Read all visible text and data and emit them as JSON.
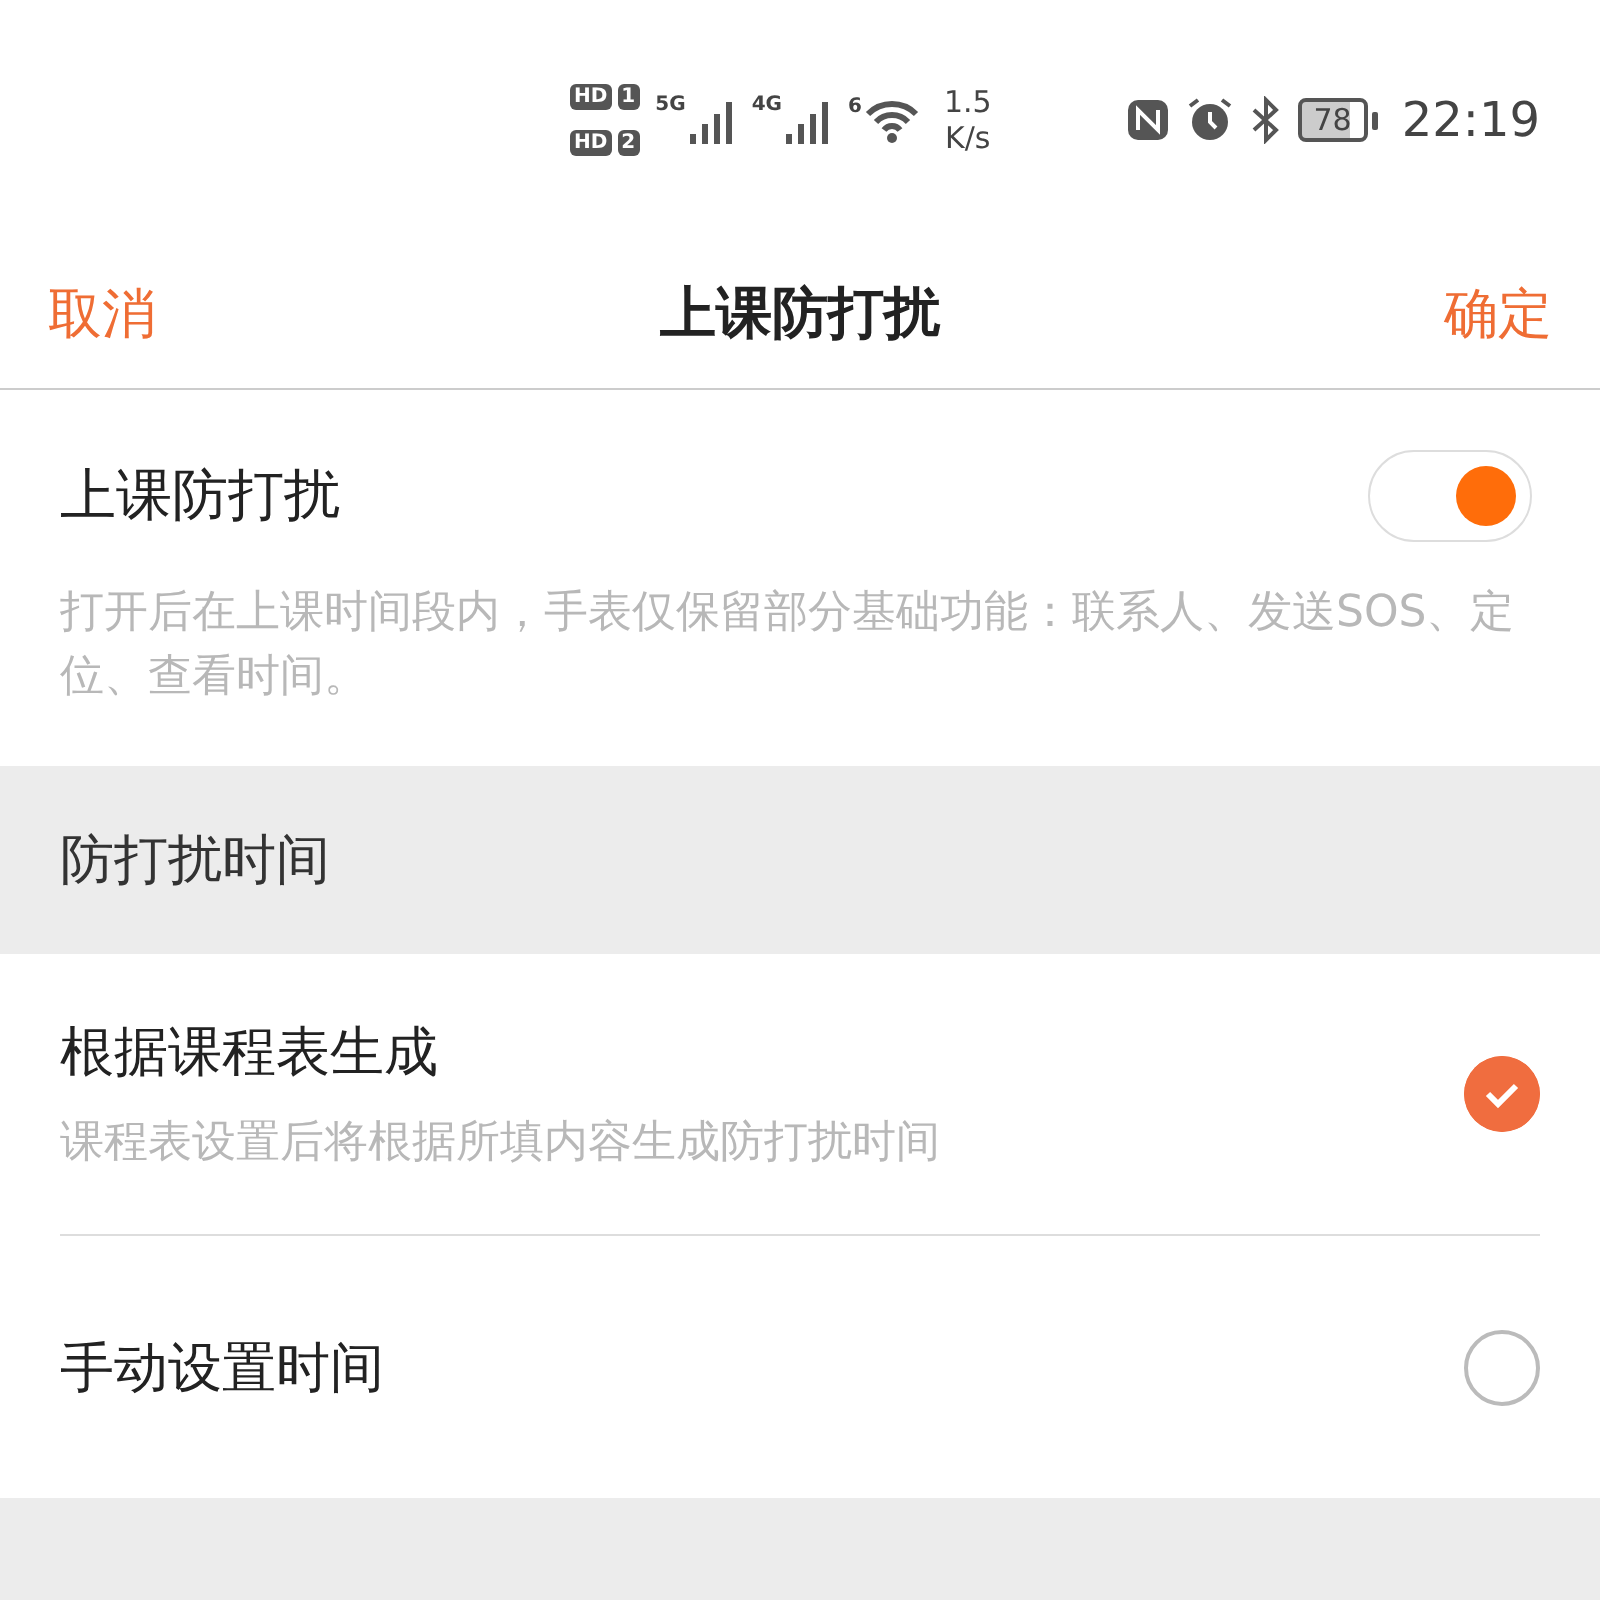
{
  "status_bar": {
    "sims": [
      {
        "label": "HD",
        "slot": "1"
      },
      {
        "label": "HD",
        "slot": "2"
      }
    ],
    "networks": [
      {
        "label": "5G"
      },
      {
        "label": "4G"
      }
    ],
    "wifi_label": "6",
    "speed": "1.5",
    "speed_unit": "K/s",
    "battery": "78",
    "time": "22:19"
  },
  "nav": {
    "cancel": "取消",
    "title": "上课防打扰",
    "confirm": "确定"
  },
  "toggle": {
    "title": "上课防打扰",
    "on": true,
    "description": "打开后在上课时间段内，手表仅保留部分基础功能：联系人、发送SOS、定位、查看时间。"
  },
  "section_header": "防打扰时间",
  "options": [
    {
      "title": "根据课程表生成",
      "subtitle": "课程表设置后将根据所填内容生成防打扰时间",
      "selected": true
    },
    {
      "title": "手动设置时间",
      "selected": false
    }
  ]
}
